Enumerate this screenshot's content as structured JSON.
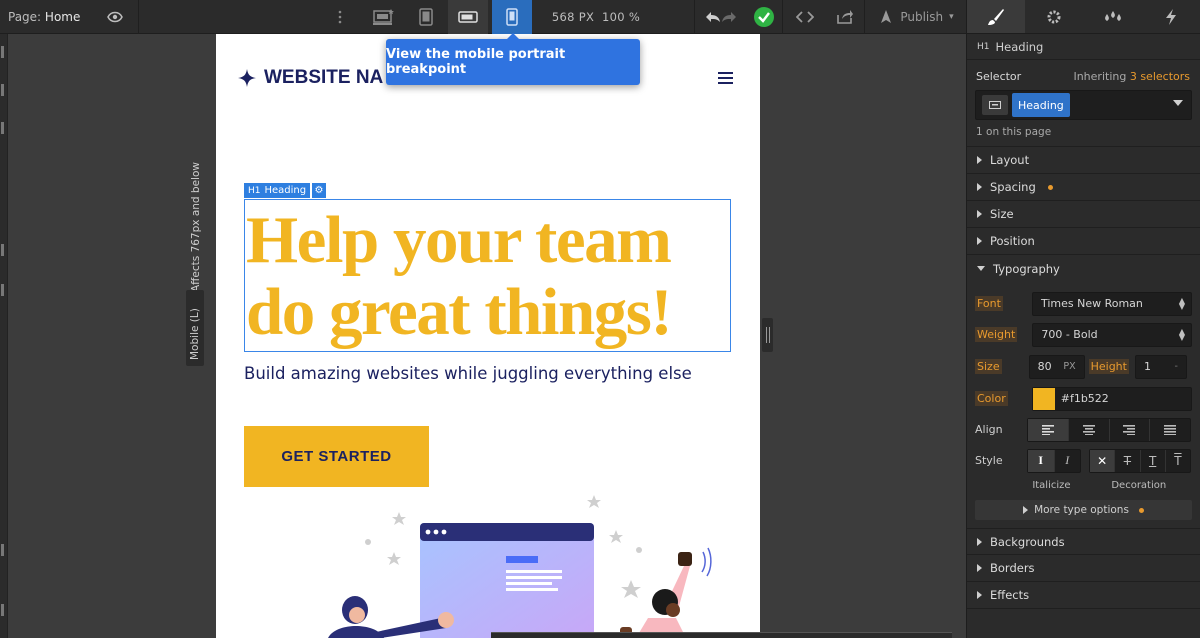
{
  "topbar": {
    "page_prefix": "Page:",
    "page_name": "Home",
    "canvas_width": "568 PX",
    "zoom": "100 %",
    "publish_label": "Publish"
  },
  "tooltip": {
    "text": "View the mobile portrait breakpoint"
  },
  "canvas": {
    "mobile_tag": "Mobile (L)",
    "affects_text": "Affects 767px and below"
  },
  "site": {
    "brand": "WEBSITE NA",
    "heading_line1": "Help your team",
    "heading_line2": "do great things!",
    "subtext": "Build amazing websites while juggling everything else",
    "cta": "GET STARTED",
    "h1_badge_tag": "H1",
    "h1_badge_label": "Heading"
  },
  "panel": {
    "element_tag": "H1",
    "element_name": "Heading",
    "selector_label": "Selector",
    "inheriting_prefix": "Inheriting",
    "inheriting_count": "3 selectors",
    "selector_chip": "Heading",
    "on_page": "1 on this page",
    "sections_top": [
      "Layout",
      "Spacing",
      "Size",
      "Position"
    ],
    "typography": {
      "title": "Typography",
      "font_label": "Font",
      "font_value": "Times New Roman",
      "weight_label": "Weight",
      "weight_value": "700 - Bold",
      "size_label": "Size",
      "size_value": "80",
      "size_unit": "PX",
      "height_label": "Height",
      "height_value": "1",
      "height_unit": "-",
      "color_label": "Color",
      "color_value": "#f1b522",
      "align_label": "Align",
      "style_label": "Style",
      "italicize_label": "Italicize",
      "decoration_label": "Decoration",
      "more_options": "More type options"
    },
    "sections_bottom": [
      "Backgrounds",
      "Borders",
      "Effects"
    ]
  },
  "colors": {
    "brand_navy": "#1b2160",
    "accent_yellow": "#f1b522",
    "selection_blue": "#2f73e0",
    "modified_orange": "#e89a2e"
  }
}
